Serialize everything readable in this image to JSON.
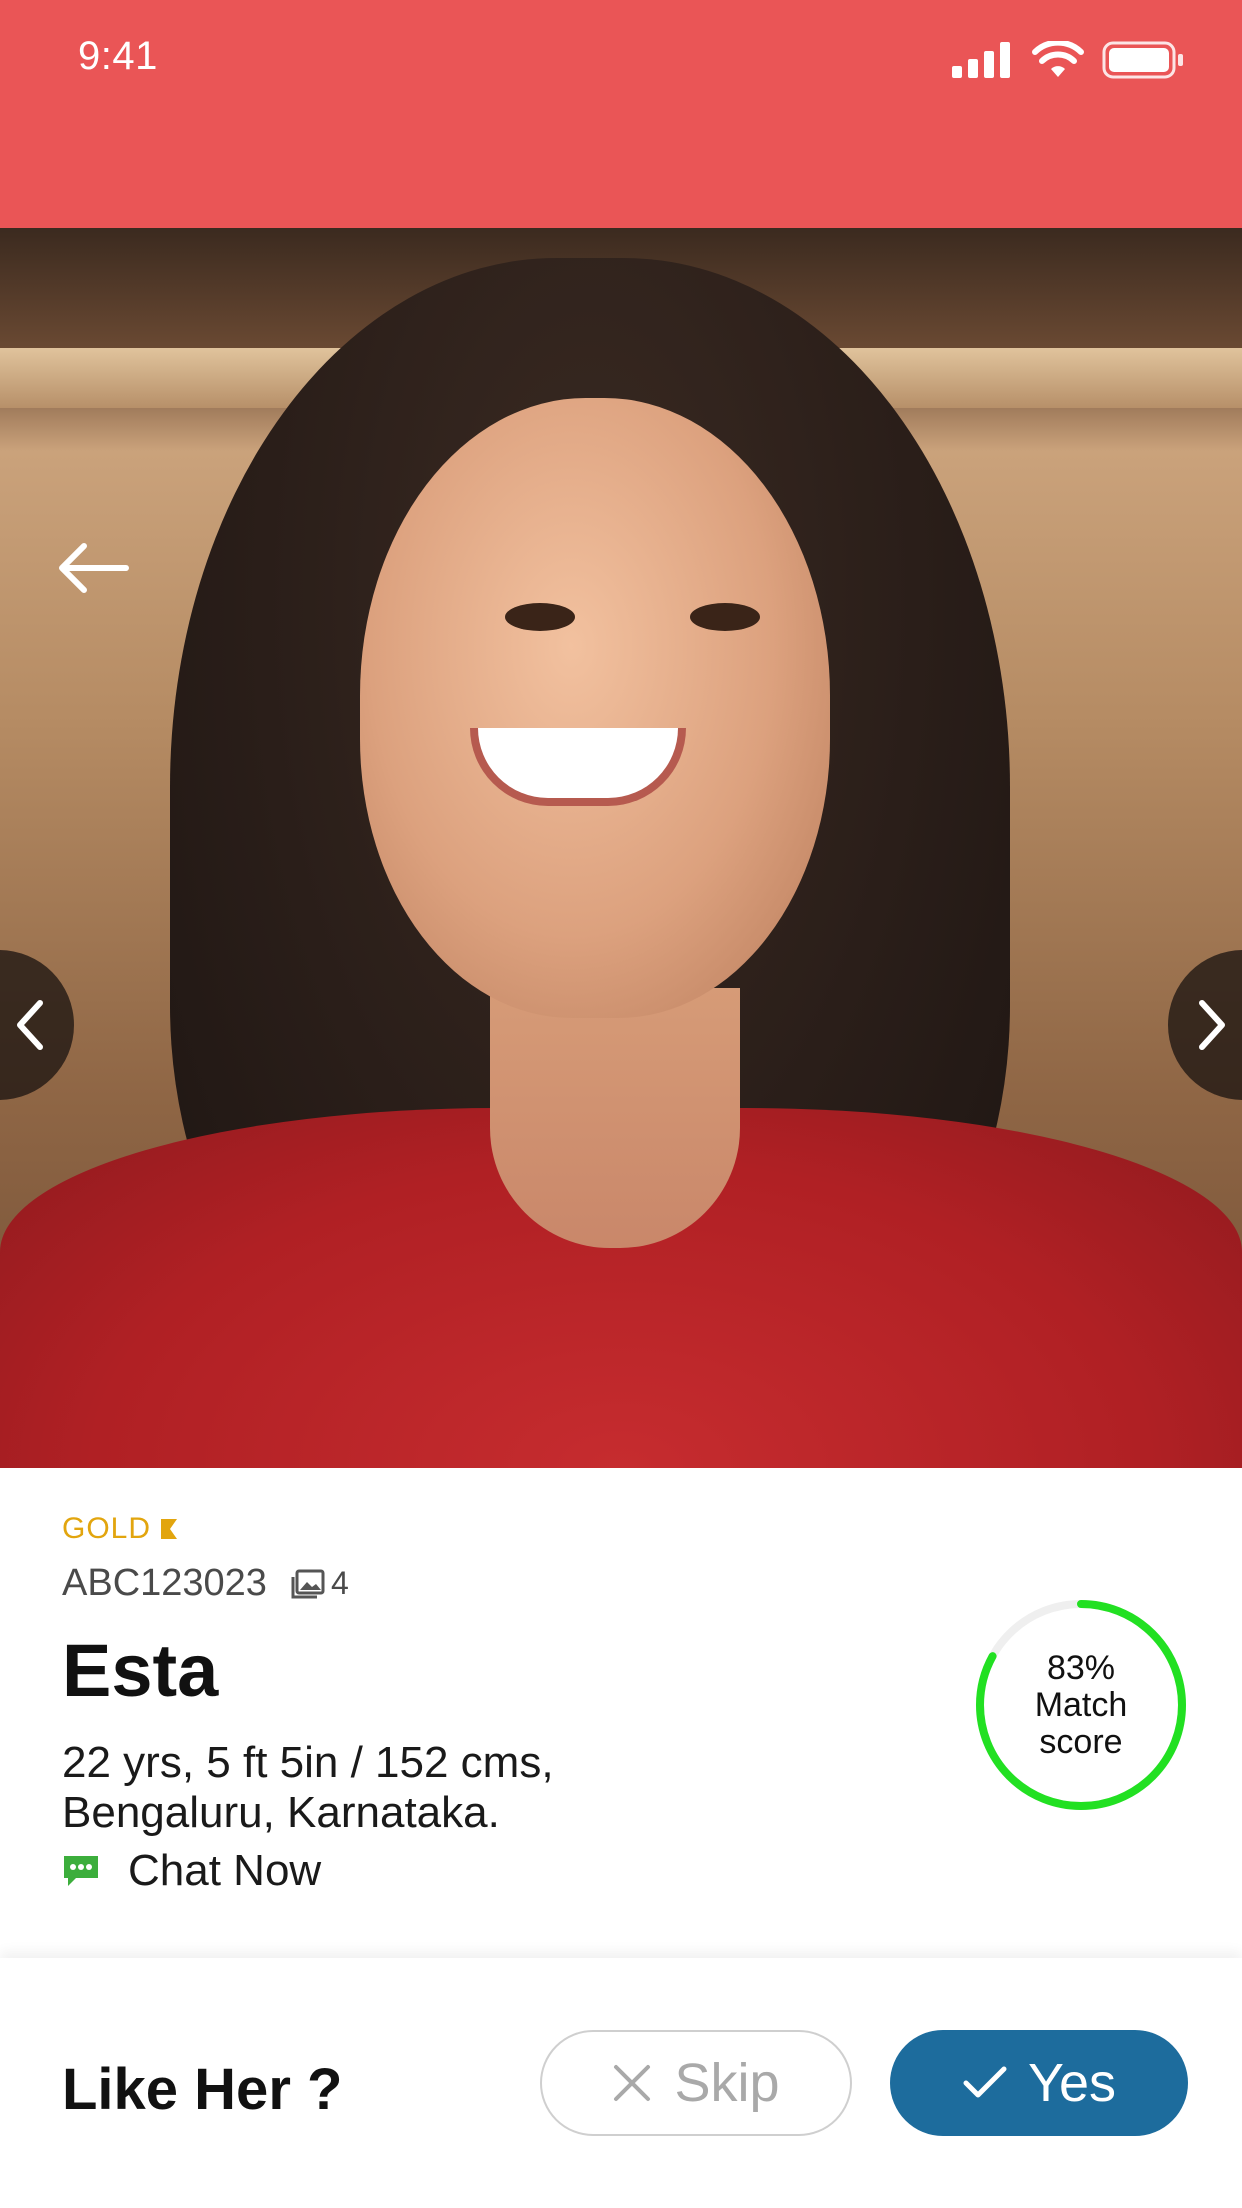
{
  "status_bar": {
    "time": "9:41",
    "icons": [
      "signal-icon",
      "wifi-icon",
      "battery-icon"
    ]
  },
  "colors": {
    "header": "#ea5556",
    "gold": "#e2a50e",
    "match_ring": "#22e022",
    "yes_button": "#1d6c9d"
  },
  "profile": {
    "tier": "GOLD",
    "id": "ABC123023",
    "photo_count": "4",
    "name": "Esta",
    "details_line1": "22 yrs, 5 ft 5in / 152 cms,",
    "details_line2": "Bengaluru, Karnataka.",
    "chat_label": "Chat Now"
  },
  "match": {
    "percent_label": "83%",
    "line2": "Match",
    "line3": "score",
    "value": 0.83
  },
  "actions": {
    "question": "Like Her ?",
    "skip_label": "Skip",
    "yes_label": "Yes"
  }
}
